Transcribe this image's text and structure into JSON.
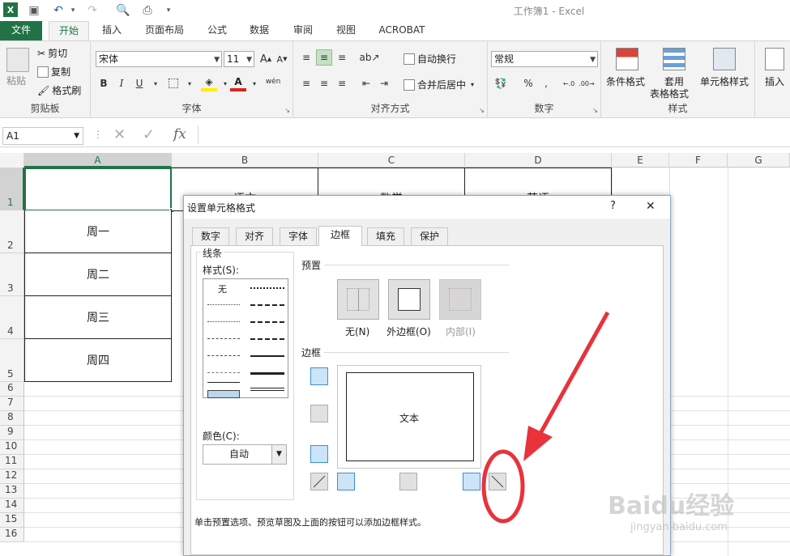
{
  "window": {
    "title": "工作簿1 - Excel"
  },
  "ribbon": {
    "tabs": [
      "文件",
      "开始",
      "插入",
      "页面布局",
      "公式",
      "数据",
      "审阅",
      "视图",
      "ACROBAT"
    ],
    "clipboard": {
      "paste": "粘贴",
      "cut": "剪切",
      "copy": "复制",
      "format_painter": "格式刷",
      "label": "剪贴板"
    },
    "font": {
      "name": "宋体",
      "size": "11",
      "wen": "wén",
      "label": "字体"
    },
    "alignment": {
      "wrap": "自动换行",
      "merge": "合并后居中",
      "label": "对齐方式"
    },
    "number": {
      "format": "常规",
      "label": "数字"
    },
    "styles": {
      "cond_format": "条件格式",
      "table_format_1": "套用",
      "table_format_2": "表格格式",
      "cell_styles": "单元格样式",
      "label": "样式"
    },
    "cells": {
      "insert": "插入"
    }
  },
  "formula_bar": {
    "name_box": "A1",
    "fx": "fx"
  },
  "columns": [
    "A",
    "B",
    "C",
    "D",
    "E",
    "F",
    "G"
  ],
  "rows": [
    "1",
    "2",
    "3",
    "4",
    "5",
    "6",
    "7",
    "8",
    "9",
    "10",
    "11",
    "12",
    "13",
    "14",
    "15",
    "16"
  ],
  "cells": {
    "B1": "语文",
    "C1": "数学",
    "D1": "英语",
    "A2": "周一",
    "A3": "周二",
    "A4": "周三",
    "A5": "周四"
  },
  "dialog": {
    "title": "设置单元格格式",
    "help": "?",
    "close": "✕",
    "tabs": [
      "数字",
      "对齐",
      "字体",
      "边框",
      "填充",
      "保护"
    ],
    "line_section": "线条",
    "style_label": "样式(S):",
    "style_none": "无",
    "color_label": "颜色(C):",
    "color_value": "自动",
    "preset_section": "预置",
    "preset_none": "无(N)",
    "preset_outline": "外边框(O)",
    "preset_inside": "内部(I)",
    "border_section": "边框",
    "preview_text": "文本",
    "hint": "单击预置选项、预览草图及上面的按钮可以添加边框样式。"
  },
  "watermark": {
    "brand": "Baidu经验",
    "url": "jingyan.baidu.com"
  },
  "colors": {
    "excel_green": "#217346",
    "annotation_red": "#e8323c"
  }
}
